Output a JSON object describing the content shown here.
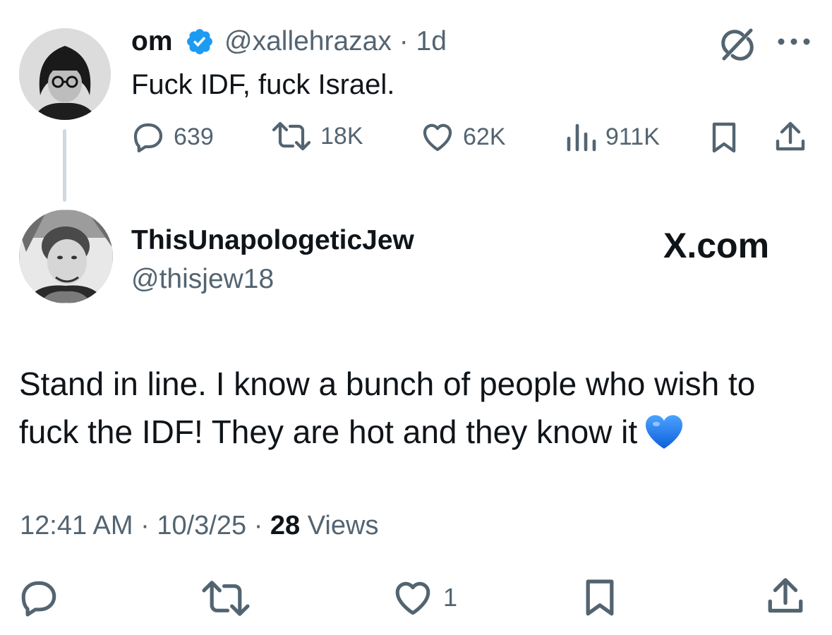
{
  "parent_tweet": {
    "display_name": "om",
    "handle": "@xallehrazax",
    "separator": "·",
    "age": "1d",
    "text": "Fuck IDF, fuck Israel.",
    "metrics": {
      "replies": "639",
      "reposts": "18K",
      "likes": "62K",
      "views": "911K"
    }
  },
  "reply_tweet": {
    "display_name": "ThisUnapologeticJew",
    "handle": "@thisjew18",
    "watermark": "X.com",
    "text": "Stand in line. I know a bunch of people who wish to fuck the IDF! They are hot and they know it",
    "emoji": "blue-heart",
    "meta": {
      "time": "12:41 AM",
      "date": "10/3/25",
      "separator": "·",
      "views_count": "28",
      "views_label": "Views"
    },
    "actions": {
      "likes": "1"
    }
  },
  "colors": {
    "text": "#0f1419",
    "secondary": "#536471",
    "verified": "#1d9bf0",
    "thread_line": "#cfd9de",
    "heart_emoji": "#1e7cf2"
  },
  "icons": [
    "verified-badge-icon",
    "grok-icon",
    "more-icon",
    "reply-icon",
    "repost-icon",
    "like-icon",
    "views-icon",
    "bookmark-icon",
    "share-icon"
  ]
}
